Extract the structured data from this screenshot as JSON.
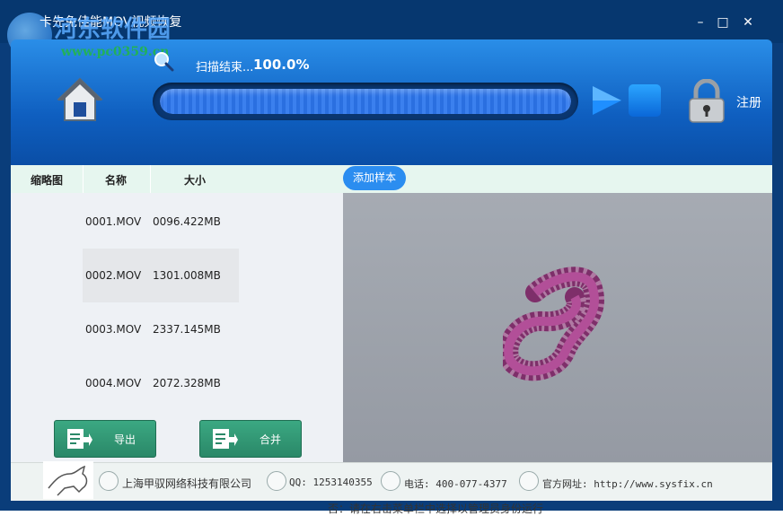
{
  "titlebar": {
    "title": "卡先免佳能MOV视频恢复",
    "watermark": "河东软件园",
    "watermark_url": "www.pc0359.cn",
    "minimize": "–",
    "maximize": "□",
    "close": "✕"
  },
  "header": {
    "status": "扫描结束...",
    "percent": "100.0%",
    "progress": 1.0,
    "register_label": "注册"
  },
  "columns": {
    "thumbnail": "缩略图",
    "name": "名称",
    "size": "大小",
    "add_sample": "添加样本"
  },
  "files": [
    {
      "name": "0001.MOV",
      "size": "0096.422MB"
    },
    {
      "name": "0002.MOV",
      "size": "1301.008MB"
    },
    {
      "name": "0003.MOV",
      "size": "2337.145MB"
    },
    {
      "name": "0004.MOV",
      "size": "2072.328MB"
    }
  ],
  "buttons": {
    "export": "导出",
    "merge": "合并"
  },
  "footer": {
    "company": "上海甲驭网络科技有限公司",
    "qq": "QQ: 1253140355",
    "phone": "电话: 400-077-4377",
    "website": "官方网址: http://www.sysfix.cn"
  },
  "bottom_caption": "否：请在右击菜单栏中选择以管理员身份运行",
  "colors": {
    "accent": "#2b8df0",
    "button_green": "#3ba882",
    "header_blue": "#0f5fc0"
  }
}
